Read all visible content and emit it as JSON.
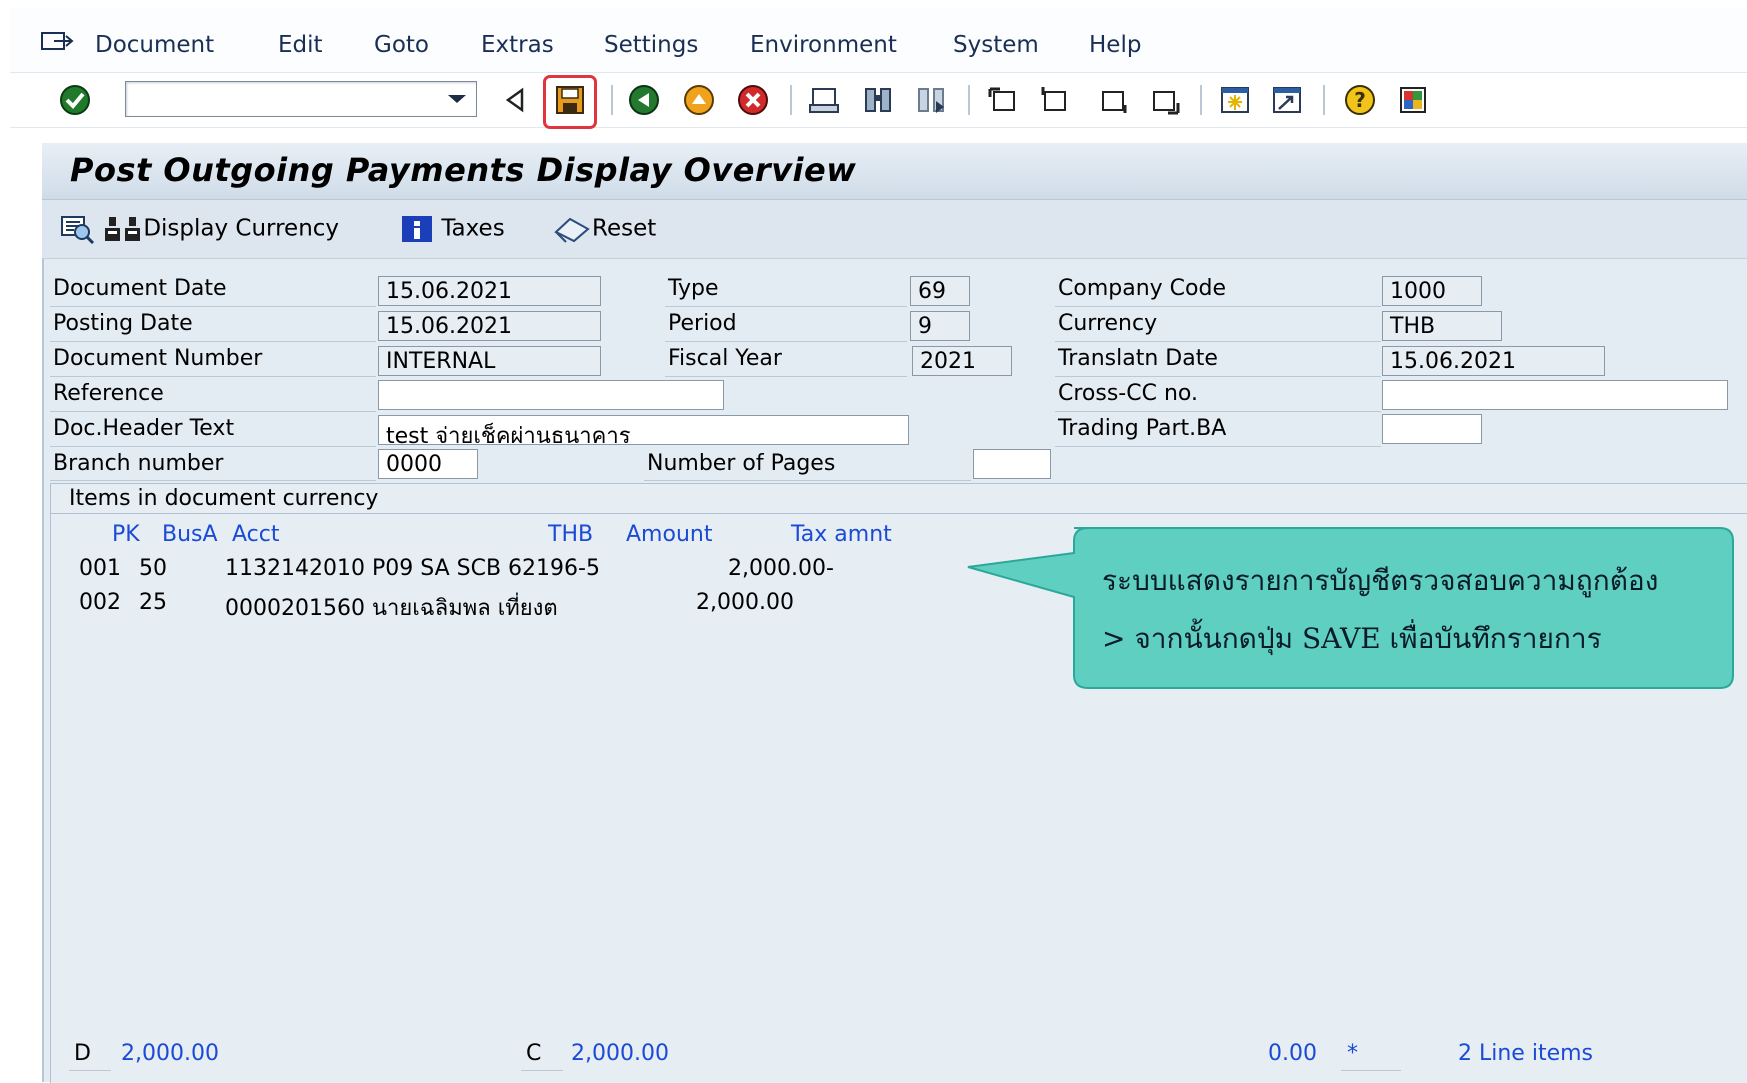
{
  "menu": {
    "items": [
      {
        "label": "Document"
      },
      {
        "label": "Edit"
      },
      {
        "label": "Goto"
      },
      {
        "label": "Extras"
      },
      {
        "label": "Settings"
      },
      {
        "label": "Environment"
      },
      {
        "label": "System"
      },
      {
        "label": "Help"
      }
    ]
  },
  "toolbar": {
    "command_value": "",
    "icons": [
      "enter-icon",
      "back-triangle-icon",
      "save-icon",
      "back-icon",
      "exit-icon",
      "cancel-icon",
      "print-icon",
      "find-icon",
      "find-next-icon",
      "first-page-icon",
      "previous-page-icon",
      "next-page-icon",
      "last-page-icon",
      "create-session-icon",
      "shortcut-icon",
      "help-icon",
      "customize-layout-icon"
    ],
    "highlight_color": "#e0343f"
  },
  "title": "Post Outgoing Payments Display Overview",
  "app_toolbar": {
    "display_currency": "Display Currency",
    "taxes": "Taxes",
    "reset": "Reset"
  },
  "header": {
    "document_date": {
      "label": "Document Date",
      "value": "15.06.2021"
    },
    "posting_date": {
      "label": "Posting Date",
      "value": "15.06.2021"
    },
    "document_number": {
      "label": "Document Number",
      "value": "INTERNAL"
    },
    "reference": {
      "label": "Reference",
      "value": ""
    },
    "doc_header_text": {
      "label": "Doc.Header Text",
      "value": "test จ่ายเช็คผ่านธนาคาร"
    },
    "branch_number": {
      "label": "Branch number",
      "value": "0000"
    },
    "type": {
      "label": "Type",
      "value": "69"
    },
    "period": {
      "label": "Period",
      "value": "9"
    },
    "fiscal_year": {
      "label": "Fiscal Year",
      "value": "2021"
    },
    "number_of_pages": {
      "label": "Number of Pages",
      "value": ""
    },
    "company_code": {
      "label": "Company Code",
      "value": "1000"
    },
    "currency": {
      "label": "Currency",
      "value": "THB"
    },
    "translatn_date": {
      "label": "Translatn Date",
      "value": "15.06.2021"
    },
    "cross_cc_no": {
      "label": "Cross-CC no.",
      "value": ""
    },
    "trading_part_ba": {
      "label": "Trading Part.BA",
      "value": ""
    }
  },
  "items": {
    "title": "Items in document currency",
    "columns": {
      "pk": "PK",
      "busa": "BusA",
      "acct": "Acct",
      "currency": "THB",
      "amount": "Amount",
      "tax": "Tax amnt"
    },
    "rows": [
      {
        "line": "001",
        "pk": "50",
        "acct": "1132142010 P09 SA SCB 62196-5",
        "amount": "2,000.00-"
      },
      {
        "line": "002",
        "pk": "25",
        "acct": "0000201560 นายเฉลิมพล  เที่ยงต",
        "amount": "2,000.00"
      }
    ],
    "footer": {
      "debit_label": "D",
      "debit_value": "2,000.00",
      "credit_label": "C",
      "credit_value": "2,000.00",
      "balance": "0.00",
      "star": "*",
      "line_items": "2 Line items"
    }
  },
  "callout": {
    "line1": "ระบบแสดงรายการบัญชีตรวจสอบความถูกต้อง",
    "line2": "> จากนั้นกดปุ่ม SAVE เพื่อบันทึกรายการ",
    "fill_color": "#5fcfc1"
  }
}
